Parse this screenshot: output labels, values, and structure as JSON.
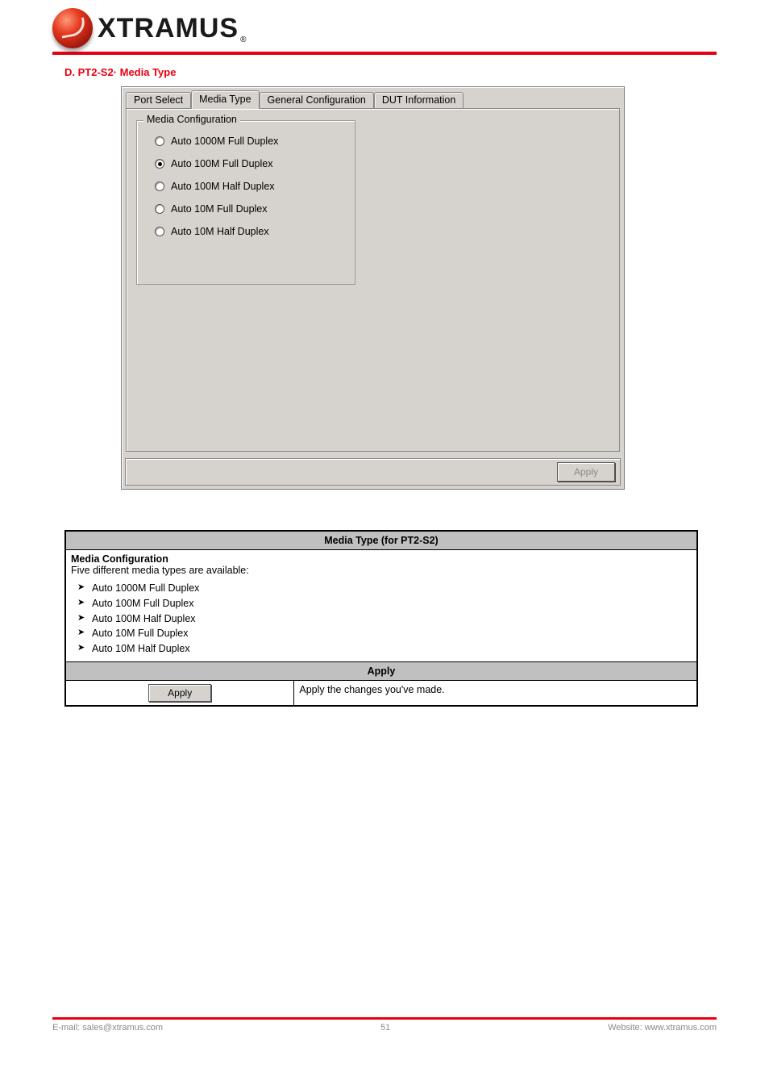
{
  "brand": {
    "name": "XTRAMUS",
    "reg": "®"
  },
  "section_title": "D. PT2-S2· Media Type",
  "tabs": [
    "Port Select",
    "Media Type",
    "General Configuration",
    "DUT Information"
  ],
  "active_tab_index": 1,
  "groupbox_title": "Media Configuration",
  "radios": [
    {
      "label": "Auto 1000M Full Duplex",
      "checked": false
    },
    {
      "label": "Auto 100M Full Duplex",
      "checked": true
    },
    {
      "label": "Auto 100M Half Duplex",
      "checked": false
    },
    {
      "label": "Auto 10M Full Duplex",
      "checked": false
    },
    {
      "label": "Auto 10M Half Duplex",
      "checked": false
    }
  ],
  "apply_button_label": "Apply",
  "table": {
    "header1": "Media Type (for PT2-S2)",
    "media_title": "Media Configuration",
    "media_intro": "Five different media types are available:",
    "media_items": [
      "Auto 1000M Full Duplex",
      "Auto 100M Full Duplex",
      "Auto 100M Half Duplex",
      "Auto 10M Full Duplex",
      "Auto 10M Half Duplex"
    ],
    "header2": "Apply",
    "apply_btn": "Apply",
    "apply_text": "Apply the changes you've made."
  },
  "footer": {
    "left": "E-mail: sales@xtramus.com",
    "center": "51",
    "right": "Website: www.xtramus.com"
  }
}
